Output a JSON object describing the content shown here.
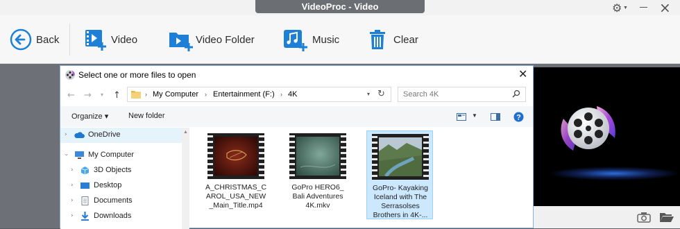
{
  "app": {
    "title": "VideoProc - Video",
    "toolbar": {
      "back_label": "Back",
      "video_label": "Video",
      "video_folder_label": "Video Folder",
      "music_label": "Music",
      "clear_label": "Clear"
    },
    "accent_color": "#1d7fd6"
  },
  "dialog": {
    "title": "Select one or more files to open",
    "address": {
      "crumbs": [
        "My Computer",
        "Entertainment (F:)",
        "4K"
      ]
    },
    "search_placeholder": "Search 4K",
    "commands": {
      "organize_label": "Organize ▾",
      "new_folder_label": "New folder"
    },
    "sidebar": {
      "items": [
        {
          "label": "OneDrive",
          "icon": "cloud-icon",
          "selected": true
        },
        {
          "label": "My Computer",
          "icon": "computer-icon"
        },
        {
          "label": "3D Objects",
          "icon": "cube-icon"
        },
        {
          "label": "Desktop",
          "icon": "desktop-icon"
        },
        {
          "label": "Documents",
          "icon": "document-icon"
        },
        {
          "label": "Downloads",
          "icon": "download-icon"
        }
      ]
    },
    "files": [
      {
        "name": "A_CHRISTMAS_CAROL_USA_NEW_Main_Title.mp4",
        "display": "A_CHRISTMAS_C AROL_USA_NEW _Main_Title.mp4"
      },
      {
        "name": "GoPro HERO6_ Bali Adventures 4K.mkv",
        "display": "GoPro HERO6_ Bali Adventures 4K.mkv"
      },
      {
        "name": "GoPro- Kayaking Iceland with The Serrasolses Brothers in 4K-...",
        "display": "GoPro- Kayaking Iceland with The Serrasolses Brothers in 4K-...",
        "selected": true
      }
    ]
  }
}
